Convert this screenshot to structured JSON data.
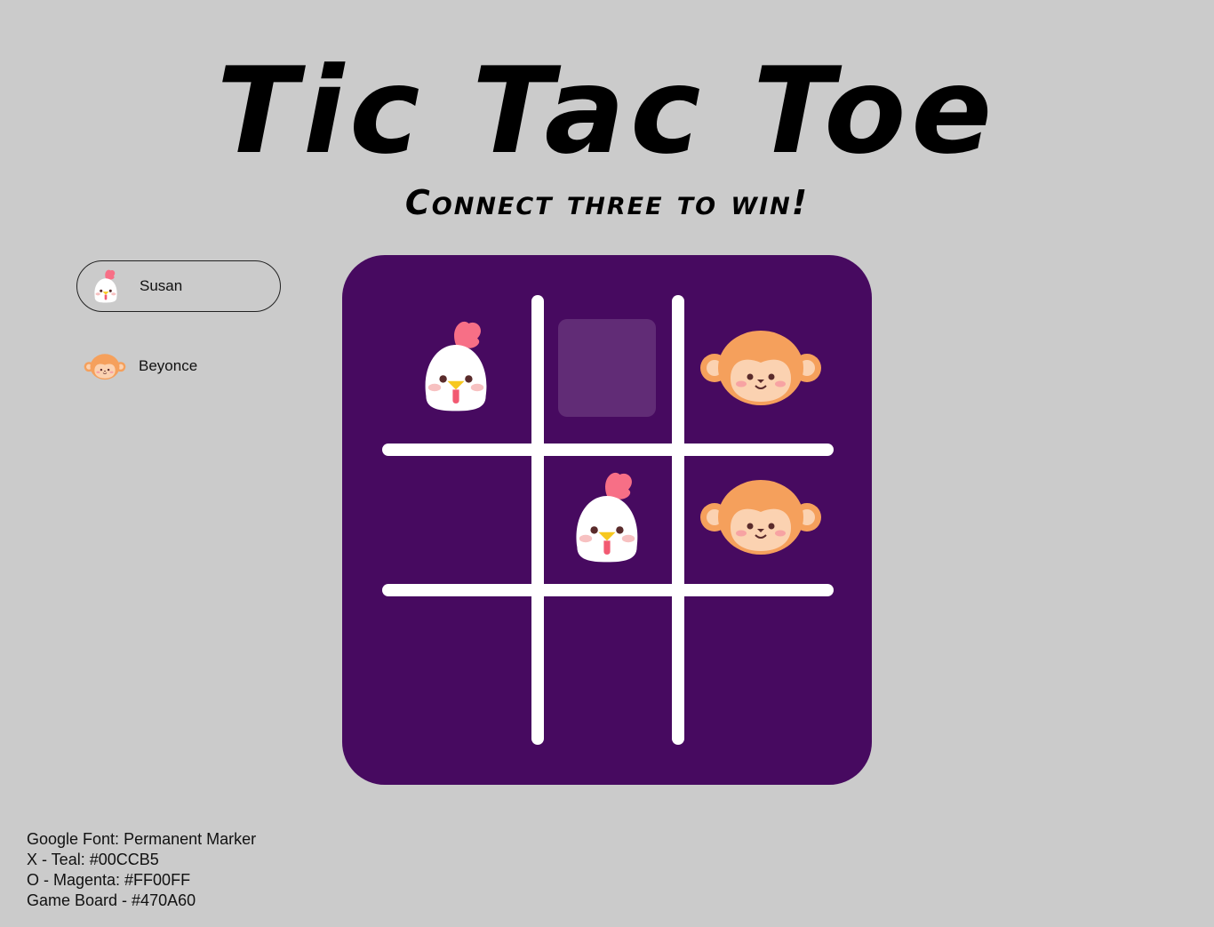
{
  "title": "Tic Tac Toe",
  "subtitle": "Connect three to win!",
  "players": [
    {
      "name": "Susan",
      "icon": "chicken-icon",
      "active": true
    },
    {
      "name": "Beyonce",
      "icon": "monkey-icon",
      "active": false
    }
  ],
  "board": {
    "color": "#470A60",
    "cells": [
      "chicken",
      "empty-hover",
      "monkey",
      "empty",
      "chicken",
      "monkey",
      "empty",
      "empty",
      "empty"
    ]
  },
  "notes": [
    "Google Font: Permanent Marker",
    "X - Teal: #00CCB5",
    "O - Magenta: #FF00FF",
    "Game Board - #470A60"
  ],
  "colors": {
    "background": "#CBCBCB",
    "x_teal": "#00CCB5",
    "o_magenta": "#FF00FF",
    "board": "#470A60"
  }
}
